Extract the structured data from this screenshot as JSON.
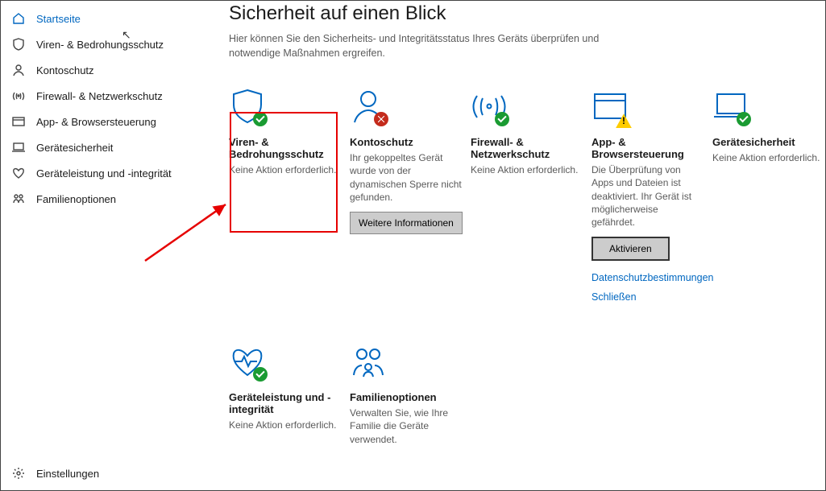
{
  "sidebar": {
    "items": [
      {
        "label": "Startseite"
      },
      {
        "label": "Viren- & Bedrohungsschutz"
      },
      {
        "label": "Kontoschutz"
      },
      {
        "label": "Firewall- & Netzwerkschutz"
      },
      {
        "label": "App- & Browsersteuerung"
      },
      {
        "label": "Gerätesicherheit"
      },
      {
        "label": "Geräteleistung und -integrität"
      },
      {
        "label": "Familienoptionen"
      }
    ],
    "footer": {
      "label": "Einstellungen"
    }
  },
  "main": {
    "title": "Sicherheit auf einen Blick",
    "desc": "Hier können Sie den Sicherheits- und Integritätsstatus Ihres Geräts überprüfen und notwendige Maßnahmen ergreifen."
  },
  "tiles_row1": [
    {
      "title": "Viren- & Bedrohungsschutz",
      "desc": "Keine Aktion erforderlich."
    },
    {
      "title": "Kontoschutz",
      "desc": "Ihr gekoppeltes Gerät wurde von der dynamischen Sperre nicht gefunden.",
      "button": "Weitere Informationen"
    },
    {
      "title": "Firewall- & Netzwerkschutz",
      "desc": "Keine Aktion erforderlich."
    },
    {
      "title": "App- & Browsersteuerung",
      "desc": "Die Überprüfung von Apps und Dateien ist deaktiviert. Ihr Gerät ist möglicherweise gefährdet.",
      "button": "Aktivieren",
      "link1": "Datenschutzbestimmungen",
      "link2": "Schließen"
    },
    {
      "title": "Gerätesicherheit",
      "desc": "Keine Aktion erforderlich."
    }
  ],
  "tiles_row2": [
    {
      "title": "Geräteleistung und -integrität",
      "desc": "Keine Aktion erforderlich."
    },
    {
      "title": "Familienoptionen",
      "desc": "Verwalten Sie, wie Ihre Familie die Geräte verwendet."
    }
  ]
}
